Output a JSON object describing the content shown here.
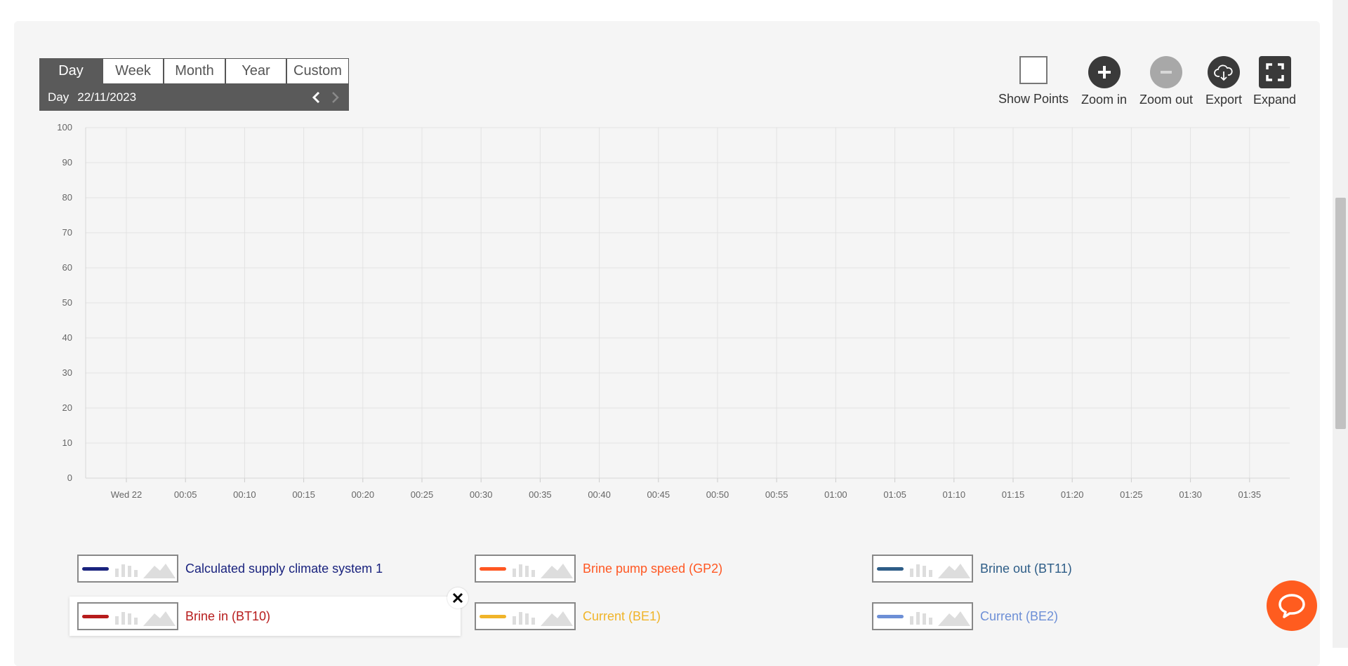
{
  "period": {
    "tabs": [
      "Day",
      "Week",
      "Month",
      "Year",
      "Custom"
    ],
    "active_tab": "Day",
    "day_label": "Day",
    "date": "22/11/2023"
  },
  "toolbar": {
    "show_points_label": "Show Points",
    "zoom_in_label": "Zoom in",
    "zoom_out_label": "Zoom out",
    "export_label": "Export",
    "expand_label": "Expand"
  },
  "chart_data": {
    "type": "line",
    "title": "",
    "xlabel": "",
    "ylabel": "",
    "ylim": [
      0,
      100
    ],
    "yticks": [
      0,
      10,
      20,
      30,
      40,
      50,
      60,
      70,
      80,
      90,
      100
    ],
    "xticks": [
      "Wed 22",
      "00:05",
      "00:10",
      "00:15",
      "00:20",
      "00:25",
      "00:30",
      "00:35",
      "00:40",
      "00:45",
      "00:50",
      "00:55",
      "01:00",
      "01:05",
      "01:10",
      "01:15",
      "01:20",
      "01:25",
      "01:30",
      "01:35"
    ],
    "grid": true,
    "series": []
  },
  "legend": [
    {
      "label": "Calculated supply climate system 1",
      "color": "#1a237e"
    },
    {
      "label": "Brine pump speed (GP2)",
      "color": "#ff5722"
    },
    {
      "label": "Brine out (BT11)",
      "color": "#2e5d87"
    },
    {
      "label": "Brine in (BT10)",
      "color": "#b71c1c"
    },
    {
      "label": "Current (BE1)",
      "color": "#f0b429"
    },
    {
      "label": "Current (BE2)",
      "color": "#6d8fd6"
    }
  ],
  "colors": {
    "accent": "#ff5c1f",
    "dark": "#3a3a3a"
  }
}
